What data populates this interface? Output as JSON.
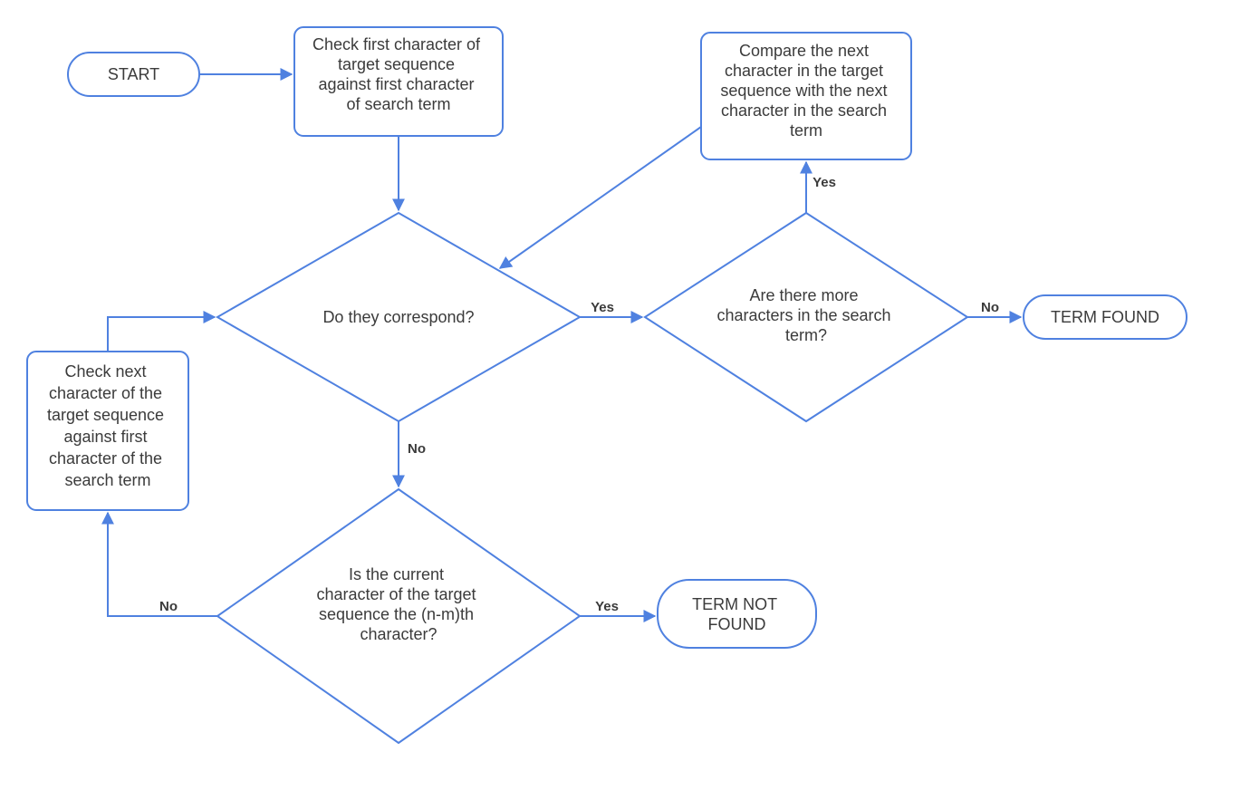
{
  "nodes": {
    "start": "START",
    "check_first": "Check first character of\ntarget sequence\nagainst first character\nof search term",
    "compare_next": "Compare the next\ncharacter in the target\nsequence with the next\ncharacter in the search\nterm",
    "do_correspond": "Do they correspond?",
    "more_chars": "Are there more\ncharacters in the search\nterm?",
    "term_found": "TERM FOUND",
    "check_next": "Check next\ncharacter of the\ntarget sequence\nagainst first\ncharacter of the\nsearch term",
    "is_nm": "Is the current\ncharacter of the target\nsequence the (n-m)th\ncharacter?",
    "term_not_found": "TERM NOT\nFOUND"
  },
  "edge_labels": {
    "yes": "Yes",
    "no": "No"
  }
}
